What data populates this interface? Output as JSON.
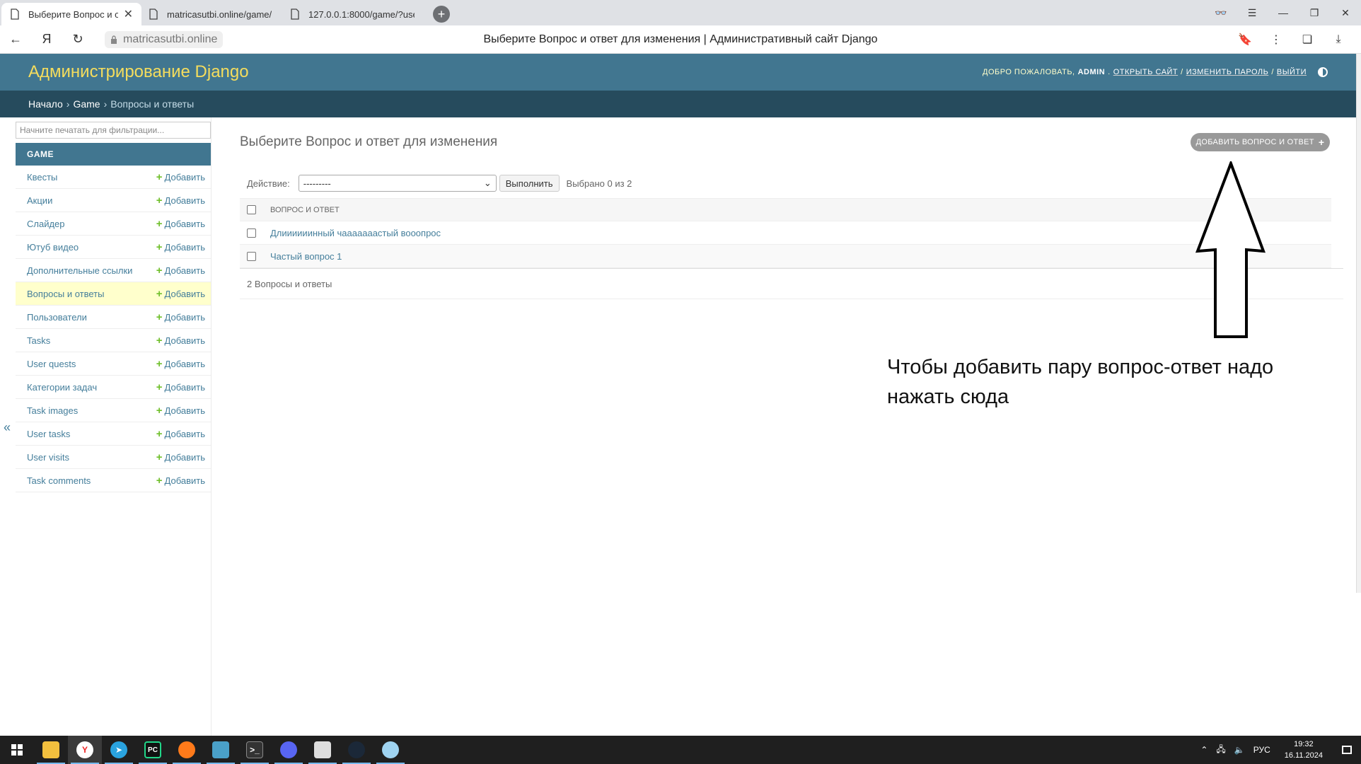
{
  "browser": {
    "tabs": [
      {
        "title": "Выберите Вопрос и от",
        "active": true
      },
      {
        "title": "matricasutbi.online/game/",
        "active": false
      },
      {
        "title": "127.0.0.1:8000/game/?use",
        "active": false
      }
    ],
    "url_domain": "matricasutbi.online",
    "page_title": "Выберите Вопрос и ответ для изменения | Административный сайт Django"
  },
  "header": {
    "brand": "Администрирование Django",
    "welcome": "Добро пожаловать,",
    "username": "admin",
    "view_site": "Открыть сайт",
    "change_password": "Изменить пароль",
    "logout": "Выйти"
  },
  "breadcrumbs": {
    "home": "Начало",
    "app": "Game",
    "current": "Вопросы и ответы"
  },
  "sidebar": {
    "filter_placeholder": "Начните печатать для фильтрации...",
    "app_name": "Game",
    "add_label": "Добавить",
    "models": [
      {
        "label": "Квесты",
        "current": false
      },
      {
        "label": "Акции",
        "current": false
      },
      {
        "label": "Слайдер",
        "current": false
      },
      {
        "label": "Ютуб видео",
        "current": false
      },
      {
        "label": "Дополнительные ссылки",
        "current": false
      },
      {
        "label": "Вопросы и ответы",
        "current": true
      },
      {
        "label": "Пользователи",
        "current": false
      },
      {
        "label": "Tasks",
        "current": false
      },
      {
        "label": "User quests",
        "current": false
      },
      {
        "label": "Категории задач",
        "current": false
      },
      {
        "label": "Task images",
        "current": false
      },
      {
        "label": "User tasks",
        "current": false
      },
      {
        "label": "User visits",
        "current": false
      },
      {
        "label": "Task comments",
        "current": false
      }
    ],
    "collapse_glyph": "«"
  },
  "content": {
    "title": "Выберите Вопрос и ответ для изменения",
    "add_button": "Добавить Вопрос и ответ",
    "action_label": "Действие:",
    "action_selected": "---------",
    "go_button": "Выполнить",
    "selected_count": "Выбрано 0 из 2",
    "column_header": "Вопрос и ответ",
    "rows": [
      "Длиииииинный чааааааастый вооопрос",
      "Частый вопрос 1"
    ],
    "paginator": "2 Вопросы и ответы"
  },
  "annotation": {
    "text": "Чтобы добавить пару вопрос-ответ надо нажать сюда"
  },
  "taskbar": {
    "apps": [
      "file-explorer-icon",
      "yandex-browser-icon",
      "telegram-icon",
      "pycharm-icon",
      "firefox-icon",
      "lock-app-icon",
      "terminal-icon",
      "discord-icon",
      "window-app-icon",
      "steam-icon",
      "paint-icon"
    ],
    "language": "РУС",
    "time": "19:32",
    "date": "16.11.2024"
  },
  "colors": {
    "header_bg": "#417690",
    "breadcrumbs_bg": "#264b5d",
    "brand_yellow": "#f5dd5d",
    "link": "#447e9b",
    "current_row": "#ffffcc",
    "add_plus": "#70bf2b"
  }
}
